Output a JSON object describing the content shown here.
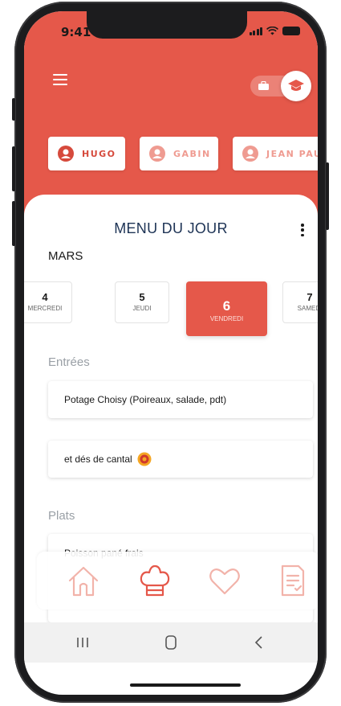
{
  "status_bar": {
    "time": "9:41"
  },
  "header": {
    "profiles": [
      {
        "name": "HUGO",
        "active": true
      },
      {
        "name": "GABIN",
        "active": false
      },
      {
        "name": "JEAN PAUL",
        "active": false
      }
    ]
  },
  "menu": {
    "title": "MENU DU JOUR",
    "month": "MARS",
    "days": [
      {
        "num": "4",
        "name": "MERCREDI"
      },
      {
        "num": "5",
        "name": "JEUDI"
      },
      {
        "num": "6",
        "name": "VENDREDI",
        "active": true
      },
      {
        "num": "7",
        "name": "SAMEDI"
      }
    ],
    "sections": {
      "entrees": {
        "label": "Entrées",
        "items": [
          "Potage Choisy (Poireaux, salade, pdt)",
          "et dés de cantal"
        ]
      },
      "plats": {
        "label": "Plats",
        "items": [
          "Poisson pané frais"
        ]
      }
    }
  },
  "bottom_nav": [
    "home-icon",
    "chef-hat-icon",
    "heart-icon",
    "document-icon"
  ],
  "colors": {
    "accent": "#e5584a",
    "title": "#1d3355",
    "section_label": "#9aa0a6",
    "nav_icon": "#f2b3aa"
  }
}
